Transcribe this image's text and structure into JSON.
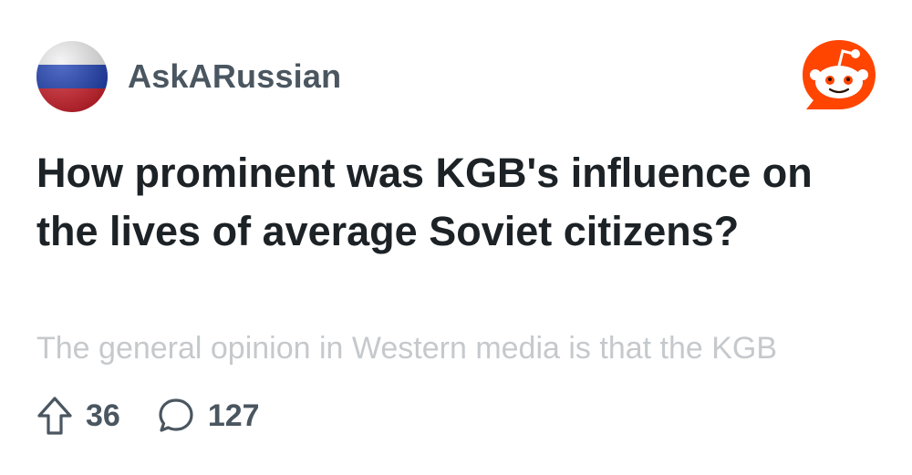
{
  "community": {
    "name": "AskARussian",
    "avatar_icon": "russian-flag-avatar",
    "flag_colors": [
      "#ffffff",
      "#1c3fb5",
      "#d6202b"
    ]
  },
  "brand": {
    "logo_icon": "reddit-logo-icon",
    "accent": "#ff4500"
  },
  "post": {
    "title": "How prominent was KGB's influence on the lives of average Soviet citizens?",
    "preview": "The general opinion in Western media is that the KGB"
  },
  "stats": {
    "upvotes": "36",
    "upvote_icon": "upvote-arrow-icon",
    "comments": "127",
    "comment_icon": "comment-bubble-icon"
  }
}
